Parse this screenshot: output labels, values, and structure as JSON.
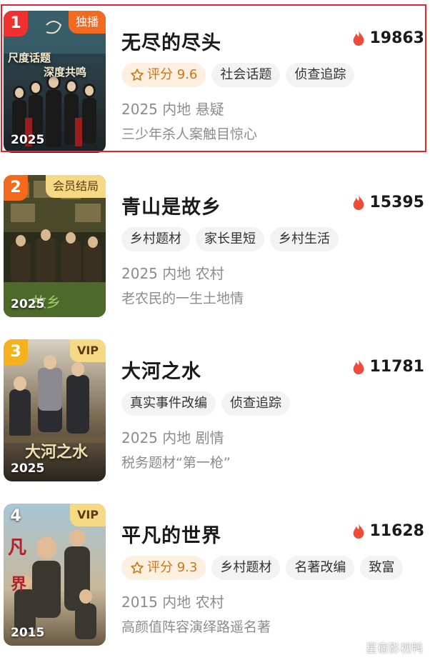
{
  "items": [
    {
      "rank": "1",
      "badge": "独播",
      "title": "无尽的尽头",
      "heat": "19863",
      "score_label": "评分 9.6",
      "tags": [
        "社会话题",
        "侦查追踪"
      ],
      "meta": "2025 内地 悬疑",
      "desc": "三少年杀人案触目惊心",
      "poster_year": "2025",
      "poster_lines": [
        "尺度话题",
        "深度共鸣"
      ]
    },
    {
      "rank": "2",
      "badge": "会员结局",
      "title": "青山是故乡",
      "heat": "15395",
      "tags": [
        "乡村题材",
        "家长里短",
        "乡村生活"
      ],
      "meta": "2025 内地 农村",
      "desc": "老农民的一生土地情",
      "poster_year": "2025"
    },
    {
      "rank": "3",
      "badge": "VIP",
      "title": "大河之水",
      "heat": "11781",
      "tags": [
        "真实事件改编",
        "侦查追踪"
      ],
      "meta": "2025 内地 剧情",
      "desc": "税务题材“第一枪”",
      "poster_year": "2025",
      "poster_lines": [
        "大河之水"
      ]
    },
    {
      "rank": "4",
      "badge": "VIP",
      "title": "平凡的世界",
      "heat": "11628",
      "score_label": "评分 9.3",
      "tags": [
        "乡村题材",
        "名著改编",
        "致富"
      ],
      "meta": "2015 内地 农村",
      "desc": "高颜值阵容演绎路遥名著",
      "poster_year": "2015"
    }
  ],
  "watermark": "星宿影视鸭",
  "colors": {
    "highlight_border": "#e0262c",
    "heat_icon": "#f04a3a",
    "score_text": "#c8781a"
  },
  "icons": {
    "heat": "flame-icon",
    "score": "star-icon"
  }
}
